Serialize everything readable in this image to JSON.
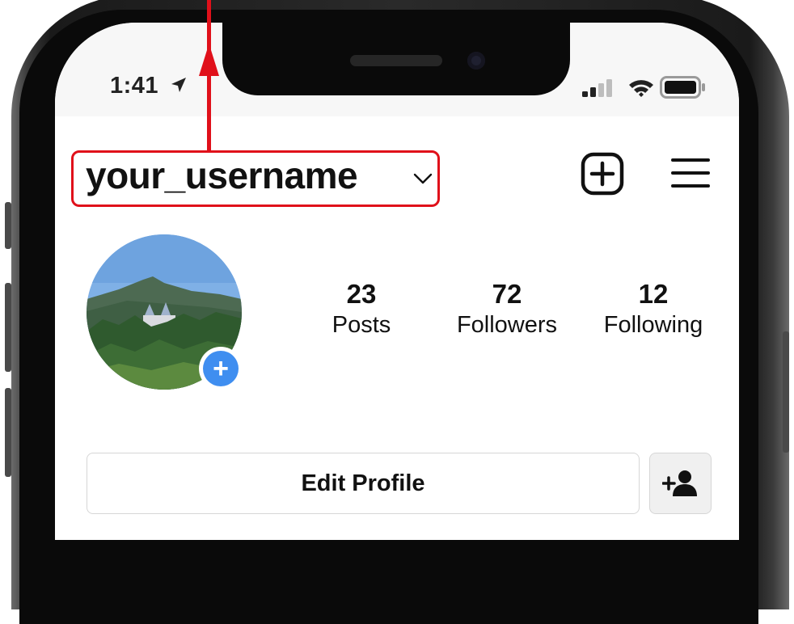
{
  "status_bar": {
    "time": "1:41",
    "icons": [
      "location-arrow-icon",
      "cellular-signal-icon",
      "wifi-icon",
      "battery-icon"
    ]
  },
  "header": {
    "username": "your_username",
    "icons": [
      "chevron-down-icon",
      "new-post-icon",
      "menu-icon"
    ]
  },
  "profile": {
    "avatar": "mountain-landscape-photo",
    "add_story_symbol": "+",
    "stats": [
      {
        "value": "23",
        "label": "Posts"
      },
      {
        "value": "72",
        "label": "Followers"
      },
      {
        "value": "12",
        "label": "Following"
      }
    ],
    "edit_profile_label": "Edit Profile",
    "add_friend_icon": "add-person-icon"
  },
  "annotation": {
    "highlight_color": "#e0101a"
  }
}
